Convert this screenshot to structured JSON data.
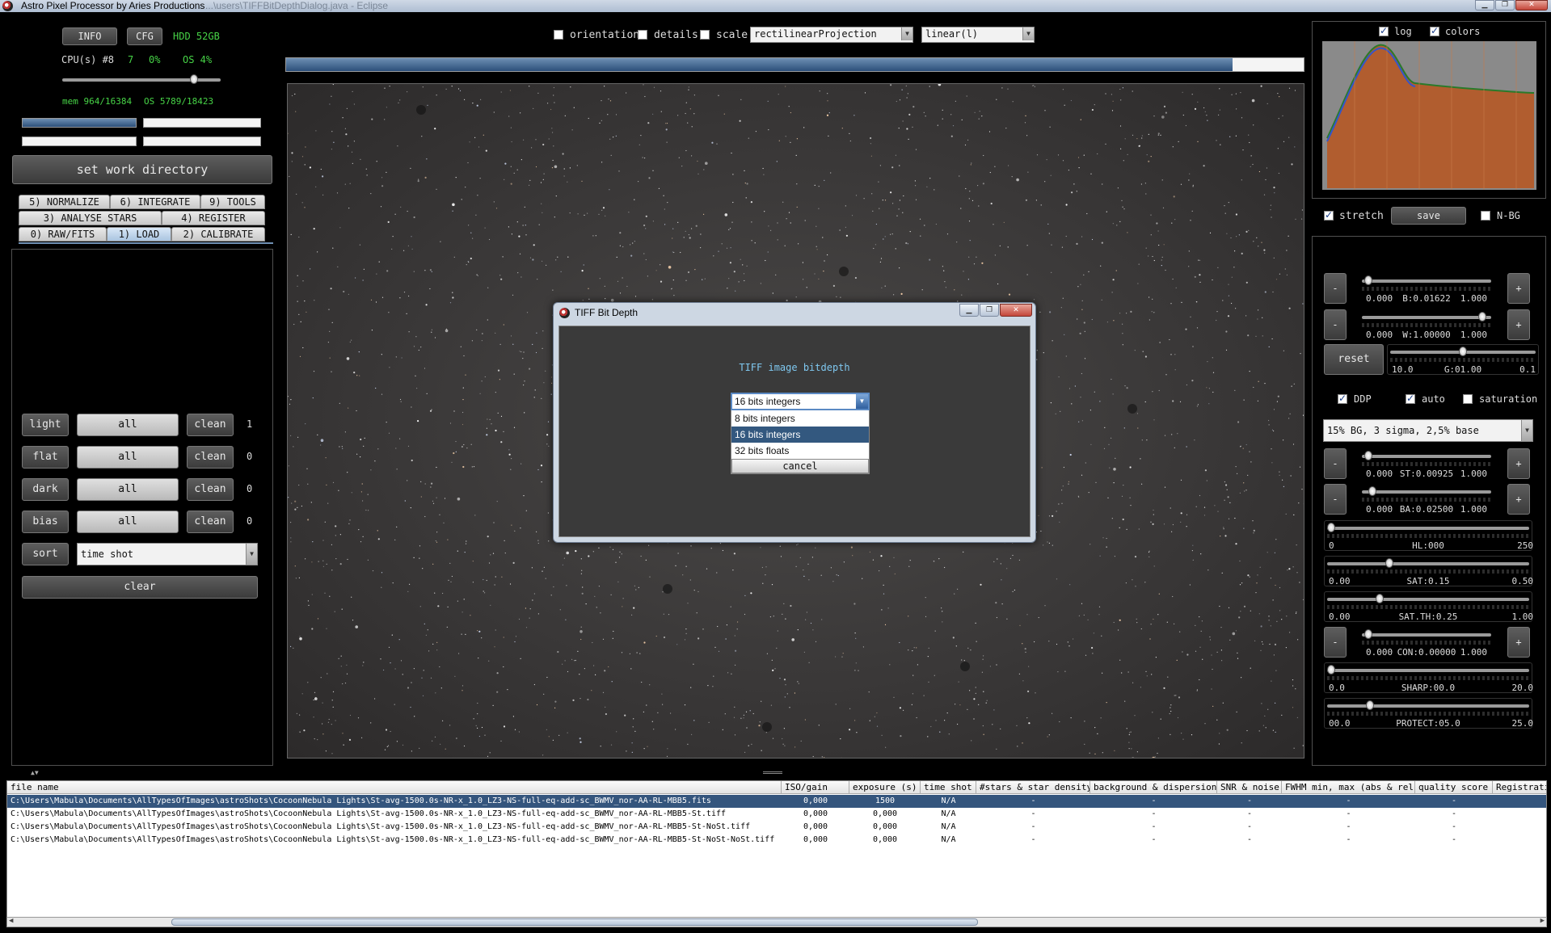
{
  "window": {
    "title": "Astro Pixel Processor by Aries Productions",
    "title_dim": "...\\users\\TIFFBitDepthDialog.java - Eclipse"
  },
  "top_left": {
    "info": "INFO",
    "cfg": "CFG",
    "hdd": "HDD 52GB",
    "cpu_label": "CPU(s) #8",
    "cpu_val": "7",
    "cpu_pct": "0%",
    "os_pct": "OS 4%",
    "mem": "mem 964/16384",
    "os_mem": "OS 5789/18423",
    "set_work_dir": "set work directory"
  },
  "tabs": {
    "row1": [
      "5) NORMALIZE",
      "6) INTEGRATE",
      "9) TOOLS"
    ],
    "row2": [
      "3) ANALYSE STARS",
      "4) REGISTER"
    ],
    "row3": [
      "0) RAW/FITS",
      "1) LOAD",
      "2) CALIBRATE"
    ]
  },
  "load": {
    "rows": [
      {
        "type": "light",
        "all": "all",
        "clean": "clean",
        "count": "1"
      },
      {
        "type": "flat",
        "all": "all",
        "clean": "clean",
        "count": "0"
      },
      {
        "type": "dark",
        "all": "all",
        "clean": "clean",
        "count": "0"
      },
      {
        "type": "bias",
        "all": "all",
        "clean": "clean",
        "count": "0"
      }
    ],
    "sort": "sort",
    "sort_value": "time shot",
    "clear": "clear"
  },
  "toolbar": {
    "orientation": "orientation",
    "details": "details",
    "scale": "scale",
    "projection": "rectilinearProjection",
    "stretch_mode": "linear(l)",
    "progress": 0.93
  },
  "histogram": {
    "log": "log",
    "colors": "colors"
  },
  "right": {
    "stretch": "stretch",
    "save": "save",
    "nbg": "N-BG",
    "minus": "-",
    "plus": "+",
    "reset": "reset",
    "b": {
      "min": "0.000",
      "label": "B:0.01622",
      "max": "1.000",
      "pos": 0.02
    },
    "w": {
      "min": "0.000",
      "label": "W:1.00000",
      "max": "1.000",
      "pos": 0.96
    },
    "g": {
      "min": "10.0",
      "label": "G:01.00",
      "max": "0.1",
      "pos": 0.5
    },
    "ddp": "DDP",
    "auto": "auto",
    "saturation": "saturation",
    "preset": "15% BG, 3 sigma, 2,5% base",
    "st": {
      "min": "0.000",
      "label": "ST:0.00925",
      "max": "1.000",
      "pos": 0.02
    },
    "ba": {
      "min": "0.000",
      "label": "BA:0.02500",
      "max": "1.000",
      "pos": 0.05
    },
    "hl": {
      "min": "0",
      "label": "HL:000",
      "max": "250",
      "pos": 0.0
    },
    "sat": {
      "min": "0.00",
      "label": "SAT:0.15",
      "max": "0.50",
      "pos": 0.3
    },
    "satth": {
      "min": "0.00",
      "label": "SAT.TH:0.25",
      "max": "1.00",
      "pos": 0.25
    },
    "con": {
      "min": "0.000",
      "label": "CON:0.00000",
      "max": "1.000",
      "pos": 0.02
    },
    "sharp": {
      "min": "0.0",
      "label": "SHARP:00.0",
      "max": "20.0",
      "pos": 0.0
    },
    "protect": {
      "min": "00.0",
      "label": "PROTECT:05.0",
      "max": "25.0",
      "pos": 0.2
    }
  },
  "dialog": {
    "title": "TIFF Bit Depth",
    "prompt": "TIFF image bitdepth",
    "selected": "16 bits integers",
    "options": [
      "8 bits integers",
      "16 bits integers",
      "32 bits floats"
    ],
    "cancel": "cancel"
  },
  "table": {
    "headers": [
      "file name",
      "ISO/gain",
      "exposure (s)",
      "time shot",
      "#stars & star density",
      "background & dispersion",
      "SNR & noise",
      "FWHM min, max (abs & rel)",
      "quality score",
      "Registrati"
    ],
    "rows": [
      [
        "C:\\Users\\Mabula\\Documents\\AllTypesOfImages\\astroShots\\CocoonNebula Lights\\St-avg-1500.0s-NR-x_1.0_LZ3-NS-full-eq-add-sc_BWMV_nor-AA-RL-MBB5.fits",
        "0,000",
        "1500",
        "N/A",
        "-",
        "-",
        "-",
        "-",
        "-"
      ],
      [
        "C:\\Users\\Mabula\\Documents\\AllTypesOfImages\\astroShots\\CocoonNebula Lights\\St-avg-1500.0s-NR-x_1.0_LZ3-NS-full-eq-add-sc_BWMV_nor-AA-RL-MBB5-St.tiff",
        "0,000",
        "0,000",
        "N/A",
        "-",
        "-",
        "-",
        "-",
        "-"
      ],
      [
        "C:\\Users\\Mabula\\Documents\\AllTypesOfImages\\astroShots\\CocoonNebula Lights\\St-avg-1500.0s-NR-x_1.0_LZ3-NS-full-eq-add-sc_BWMV_nor-AA-RL-MBB5-St-NoSt.tiff",
        "0,000",
        "0,000",
        "N/A",
        "-",
        "-",
        "-",
        "-",
        "-"
      ],
      [
        "C:\\Users\\Mabula\\Documents\\AllTypesOfImages\\astroShots\\CocoonNebula Lights\\St-avg-1500.0s-NR-x_1.0_LZ3-NS-full-eq-add-sc_BWMV_nor-AA-RL-MBB5-St-NoSt-NoSt.tiff",
        "0,000",
        "0,000",
        "N/A",
        "-",
        "-",
        "-",
        "-",
        "-"
      ]
    ]
  }
}
